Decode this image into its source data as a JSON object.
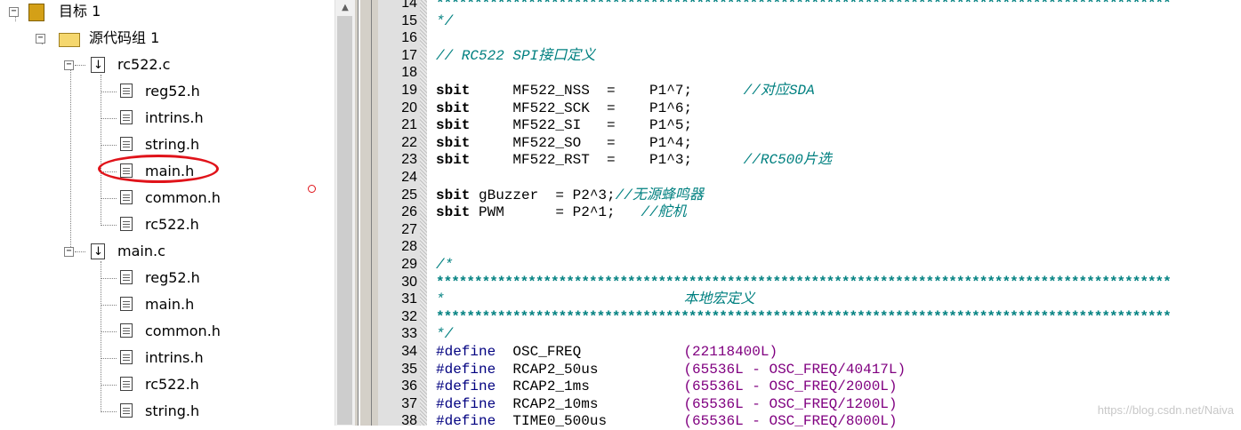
{
  "tree": {
    "target": "目标 1",
    "group": "源代码组 1",
    "files": [
      {
        "name": "rc522.c",
        "children": [
          "reg52.h",
          "intrins.h",
          "string.h",
          "main.h",
          "common.h",
          "rc522.h"
        ]
      },
      {
        "name": "main.c",
        "children": [
          "reg52.h",
          "main.h",
          "common.h",
          "intrins.h",
          "rc522.h",
          "string.h"
        ]
      }
    ]
  },
  "editor": {
    "lines": [
      {
        "n": "14",
        "t": "stars",
        "text": "************************************************************************************************"
      },
      {
        "n": "15",
        "t": "cm",
        "text": "*/"
      },
      {
        "n": "16",
        "t": "blank",
        "text": ""
      },
      {
        "n": "17",
        "t": "cm",
        "text": "// RC522 SPI接口定义"
      },
      {
        "n": "18",
        "t": "blank",
        "text": ""
      },
      {
        "n": "19",
        "t": "sbit",
        "kw": "sbit",
        "body": "     MF522_NSS  =    P1^7;      ",
        "cm": "//对应SDA"
      },
      {
        "n": "20",
        "t": "sbit",
        "kw": "sbit",
        "body": "     MF522_SCK  =    P1^6;",
        "cm": ""
      },
      {
        "n": "21",
        "t": "sbit",
        "kw": "sbit",
        "body": "     MF522_SI   =    P1^5;",
        "cm": ""
      },
      {
        "n": "22",
        "t": "sbit",
        "kw": "sbit",
        "body": "     MF522_SO   =    P1^4;",
        "cm": ""
      },
      {
        "n": "23",
        "t": "sbit",
        "kw": "sbit",
        "body": "     MF522_RST  =    P1^3;      ",
        "cm": "//RC500片选"
      },
      {
        "n": "24",
        "t": "blank",
        "text": ""
      },
      {
        "n": "25",
        "t": "sbit",
        "kw": "sbit",
        "body": " gBuzzer  = P2^3;",
        "cm": "//无源蜂鸣器"
      },
      {
        "n": "26",
        "t": "sbit",
        "kw": "sbit",
        "body": " PWM      = P2^1;   ",
        "cm": "//舵机"
      },
      {
        "n": "27",
        "t": "blank",
        "text": ""
      },
      {
        "n": "28",
        "t": "blank",
        "text": ""
      },
      {
        "n": "29",
        "t": "cm",
        "text": "/*"
      },
      {
        "n": "30",
        "t": "stars",
        "text": "************************************************************************************************"
      },
      {
        "n": "31",
        "t": "cm",
        "text": "*                            本地宏定义"
      },
      {
        "n": "32",
        "t": "stars",
        "text": "************************************************************************************************"
      },
      {
        "n": "33",
        "t": "cm",
        "text": "*/"
      },
      {
        "n": "34",
        "t": "def",
        "kw": "#define",
        "name": "  OSC_FREQ            ",
        "val": "(22118400L)"
      },
      {
        "n": "35",
        "t": "def",
        "kw": "#define",
        "name": "  RCAP2_50us          ",
        "val": "(65536L - OSC_FREQ/40417L)"
      },
      {
        "n": "36",
        "t": "def",
        "kw": "#define",
        "name": "  RCAP2_1ms           ",
        "val": "(65536L - OSC_FREQ/2000L)"
      },
      {
        "n": "37",
        "t": "def",
        "kw": "#define",
        "name": "  RCAP2_10ms          ",
        "val": "(65536L - OSC_FREQ/1200L)"
      },
      {
        "n": "38",
        "t": "def",
        "kw": "#define",
        "name": "  TIME0_500us         ",
        "val": "(65536L - OSC_FREQ/8000L)"
      }
    ]
  },
  "watermark": "https://blog.csdn.net/Naiva",
  "colors": {
    "comment": "#008080",
    "macro": "#000080",
    "number": "#800080",
    "annotation": "#e0131a"
  }
}
